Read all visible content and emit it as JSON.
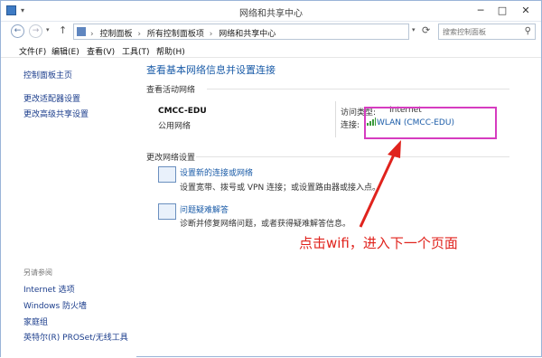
{
  "window": {
    "title": "网络和共享中心"
  },
  "titlebar": {
    "min": "─",
    "max": "□",
    "close": "✕"
  },
  "address": {
    "crumbs": [
      "控制面板",
      "所有控制面板项",
      "网络和共享中心"
    ],
    "separator": "›"
  },
  "search": {
    "placeholder": "搜索控制面板"
  },
  "menu": [
    "文件(F)",
    "编辑(E)",
    "查看(V)",
    "工具(T)",
    "帮助(H)"
  ],
  "sidebar": {
    "items": [
      "控制面板主页",
      "更改适配器设置",
      "更改高级共享设置"
    ],
    "see_also_label": "另请参阅",
    "see_also": [
      "Internet 选项",
      "Windows 防火墙",
      "家庭组",
      "英特尔(R) PROSet/无线工具"
    ]
  },
  "main": {
    "heading": "查看基本网络信息并设置连接",
    "active_networks_label": "查看活动网络",
    "network_name": "CMCC-EDU",
    "network_type": "公用网络",
    "access_type_label": "访问类型:",
    "access_type_value": "Internet",
    "connection_label": "连接:",
    "connection_value": "WLAN (CMCC-EDU)",
    "change_settings_label": "更改网络设置",
    "items": [
      {
        "title": "设置新的连接或网络",
        "desc": "设置宽带、拨号或 VPN 连接；或设置路由器或接入点。",
        "icon": "network-setup-icon"
      },
      {
        "title": "问题疑难解答",
        "desc": "诊断并修复网络问题，或者获得疑难解答信息。",
        "icon": "troubleshoot-icon"
      }
    ]
  },
  "annotation": {
    "text": "点击wifi，进入下一个页面",
    "color": "#e0231d",
    "highlight_color": "#d63cc0"
  }
}
